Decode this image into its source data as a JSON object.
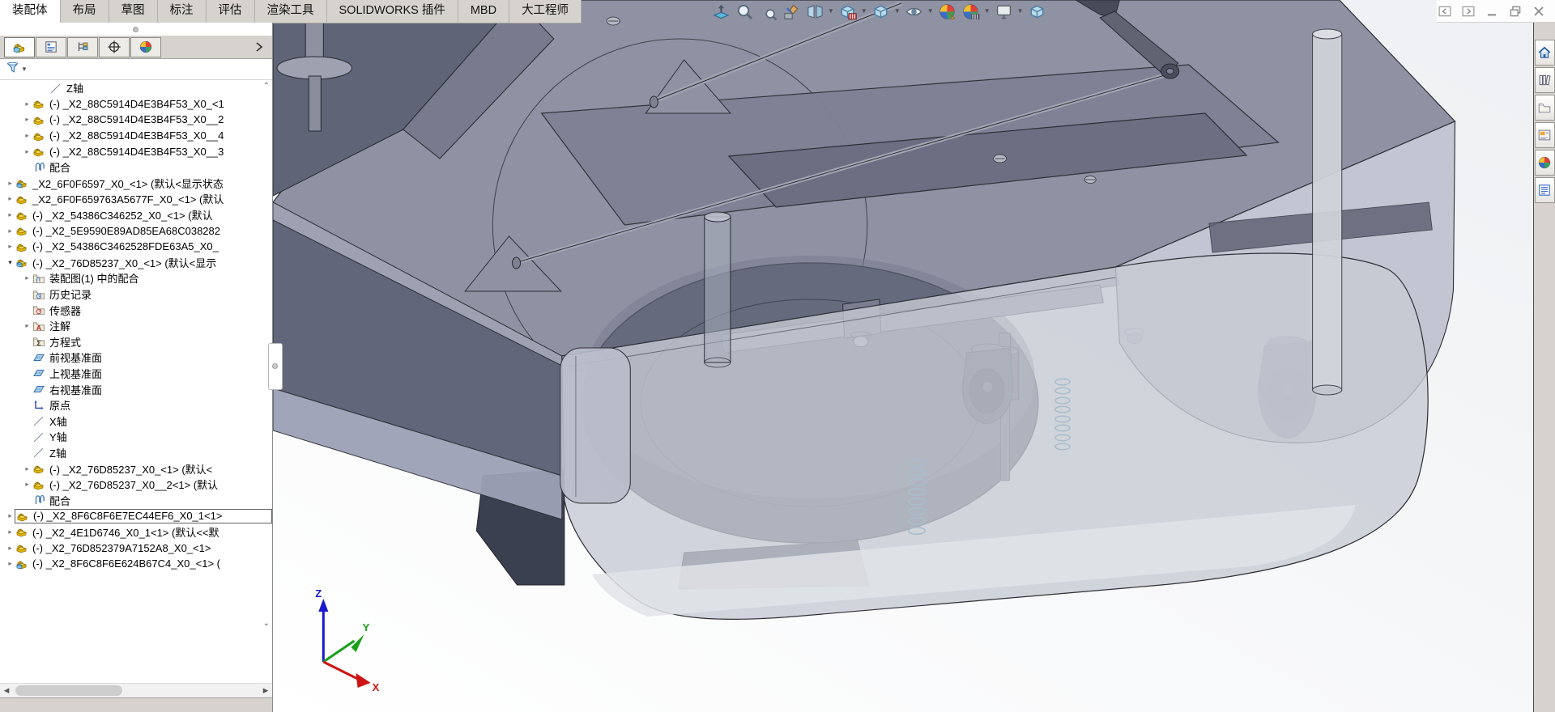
{
  "menubar": {
    "tabs": [
      {
        "label": "装配体",
        "active": true
      },
      {
        "label": "布局",
        "active": false
      },
      {
        "label": "草图",
        "active": false
      },
      {
        "label": "标注",
        "active": false
      },
      {
        "label": "评估",
        "active": false
      },
      {
        "label": "渲染工具",
        "active": false
      },
      {
        "label": "SOLIDWORKS 插件",
        "active": false
      },
      {
        "label": "MBD",
        "active": false
      },
      {
        "label": "大工程师",
        "active": false
      }
    ]
  },
  "window_controls": [
    {
      "icon": "collapse-left-icon"
    },
    {
      "icon": "collapse-right-icon"
    },
    {
      "icon": "minimize-icon"
    },
    {
      "icon": "restore-icon"
    },
    {
      "icon": "close-icon"
    }
  ],
  "headsup_toolbar": [
    {
      "icon": "zoom-to-fit-icon",
      "caret": false
    },
    {
      "icon": "zoom-to-area-icon",
      "caret": false
    },
    {
      "icon": "previous-view-icon",
      "caret": false
    },
    {
      "icon": "section-view-icon",
      "caret": false
    },
    {
      "icon": "dynamic-annotation-views-icon",
      "caret": true
    },
    {
      "icon": "view-orientation-icon",
      "caret": true
    },
    {
      "icon": "display-style-icon",
      "caret": true
    },
    {
      "icon": "hide-show-items-icon",
      "caret": true
    },
    {
      "icon": "edit-appearance-icon",
      "caret": false
    },
    {
      "icon": "apply-scene-icon",
      "caret": true
    },
    {
      "icon": "view-settings-icon",
      "caret": true
    },
    {
      "icon": "3d-drawing-view-icon",
      "caret": false
    }
  ],
  "left_panel": {
    "tabs": [
      {
        "icon": "featuremanager-tree-icon",
        "active": true
      },
      {
        "icon": "propertymanager-icon",
        "active": false
      },
      {
        "icon": "configurationmanager-icon",
        "active": false
      },
      {
        "icon": "dimxpertmanager-icon",
        "active": false
      },
      {
        "icon": "displaymanager-icon",
        "active": false
      }
    ],
    "expand_arrow_icon": "chevron-right-icon",
    "filter_icon": "filter-funnel-icon",
    "tree": [
      {
        "depth": 2,
        "arrow": "",
        "icon": "axis",
        "label": "Z轴",
        "selected": false
      },
      {
        "depth": 1,
        "arrow": "r",
        "icon": "part",
        "label": "(-) _X2_88C5914D4E3B4F53_X0_<1",
        "selected": false
      },
      {
        "depth": 1,
        "arrow": "r",
        "icon": "part",
        "label": "(-) _X2_88C5914D4E3B4F53_X0__2",
        "selected": false
      },
      {
        "depth": 1,
        "arrow": "r",
        "icon": "part",
        "label": "(-) _X2_88C5914D4E3B4F53_X0__4",
        "selected": false
      },
      {
        "depth": 1,
        "arrow": "r",
        "icon": "part",
        "label": "(-) _X2_88C5914D4E3B4F53_X0__3",
        "selected": false
      },
      {
        "depth": 1,
        "arrow": "",
        "icon": "mates",
        "label": "配合",
        "selected": false
      },
      {
        "depth": 0,
        "arrow": "r",
        "icon": "asm",
        "label": "_X2_6F0F6597_X0_<1> (默认<显示状态",
        "selected": false
      },
      {
        "depth": 0,
        "arrow": "r",
        "icon": "part",
        "label": "_X2_6F0F659763A5677F_X0_<1> (默认",
        "selected": false
      },
      {
        "depth": 0,
        "arrow": "r",
        "icon": "part",
        "label": "(-) _X2_54386C346252_X0_<1> (默认",
        "selected": false
      },
      {
        "depth": 0,
        "arrow": "r",
        "icon": "part",
        "label": "(-) _X2_5E9590E89AD85EA68C038282",
        "selected": false
      },
      {
        "depth": 0,
        "arrow": "r",
        "icon": "part",
        "label": "(-) _X2_54386C3462528FDE63A5_X0_",
        "selected": false
      },
      {
        "depth": 0,
        "arrow": "d",
        "icon": "asm",
        "label": "(-) _X2_76D85237_X0_<1> (默认<显示",
        "selected": false
      },
      {
        "depth": 1,
        "arrow": "r",
        "icon": "folder-mates",
        "label": "装配图(1) 中的配合",
        "selected": false
      },
      {
        "depth": 1,
        "arrow": "",
        "icon": "folder-history",
        "label": "历史记录",
        "selected": false
      },
      {
        "depth": 1,
        "arrow": "",
        "icon": "folder-sensor",
        "label": "传感器",
        "selected": false
      },
      {
        "depth": 1,
        "arrow": "r",
        "icon": "folder-annot",
        "label": "注解",
        "selected": false
      },
      {
        "depth": 1,
        "arrow": "",
        "icon": "folder-eq",
        "label": "方程式",
        "selected": false
      },
      {
        "depth": 1,
        "arrow": "",
        "icon": "plane",
        "label": "前视基准面",
        "selected": false
      },
      {
        "depth": 1,
        "arrow": "",
        "icon": "plane",
        "label": "上视基准面",
        "selected": false
      },
      {
        "depth": 1,
        "arrow": "",
        "icon": "plane",
        "label": "右视基准面",
        "selected": false
      },
      {
        "depth": 1,
        "arrow": "",
        "icon": "origin",
        "label": "原点",
        "selected": false
      },
      {
        "depth": 1,
        "arrow": "",
        "icon": "axis",
        "label": "X轴",
        "selected": false
      },
      {
        "depth": 1,
        "arrow": "",
        "icon": "axis",
        "label": "Y轴",
        "selected": false
      },
      {
        "depth": 1,
        "arrow": "",
        "icon": "axis",
        "label": "Z轴",
        "selected": false
      },
      {
        "depth": 1,
        "arrow": "r",
        "icon": "part",
        "label": "(-) _X2_76D85237_X0_<1> (默认<",
        "selected": false
      },
      {
        "depth": 1,
        "arrow": "r",
        "icon": "part",
        "label": "(-) _X2_76D85237_X0__2<1> (默认",
        "selected": false
      },
      {
        "depth": 1,
        "arrow": "",
        "icon": "mates",
        "label": "配合",
        "selected": false
      },
      {
        "depth": 0,
        "arrow": "r",
        "icon": "part",
        "label": "(-) _X2_8F6C8F6E7EC44EF6_X0_1<1>",
        "selected": true
      },
      {
        "depth": 0,
        "arrow": "r",
        "icon": "part",
        "label": "(-) _X2_4E1D6746_X0_1<1> (默认<<默",
        "selected": false
      },
      {
        "depth": 0,
        "arrow": "r",
        "icon": "part",
        "label": "(-) _X2_76D852379A7152A8_X0_<1>",
        "selected": false
      },
      {
        "depth": 0,
        "arrow": "r",
        "icon": "asm",
        "label": "(-) _X2_8F6C8F6E624B67C4_X0_<1> (",
        "selected": false
      }
    ]
  },
  "task_pane": [
    {
      "icon": "resources-home-icon"
    },
    {
      "icon": "design-library-icon"
    },
    {
      "icon": "file-explorer-icon"
    },
    {
      "icon": "view-palette-icon"
    },
    {
      "icon": "appearances-scenes-icon"
    },
    {
      "icon": "custom-properties-icon"
    }
  ],
  "viewport": {
    "triad": {
      "x": "X",
      "y": "Y",
      "z": "Z"
    },
    "triad_colors": {
      "x": "#cc1414",
      "y": "#18a018",
      "z": "#1a1acc"
    },
    "model_accent_colors": {
      "deck": "#8e92a2",
      "translucent_bumper": "#c7cad3",
      "spring_blue": "#2e86b5"
    }
  }
}
